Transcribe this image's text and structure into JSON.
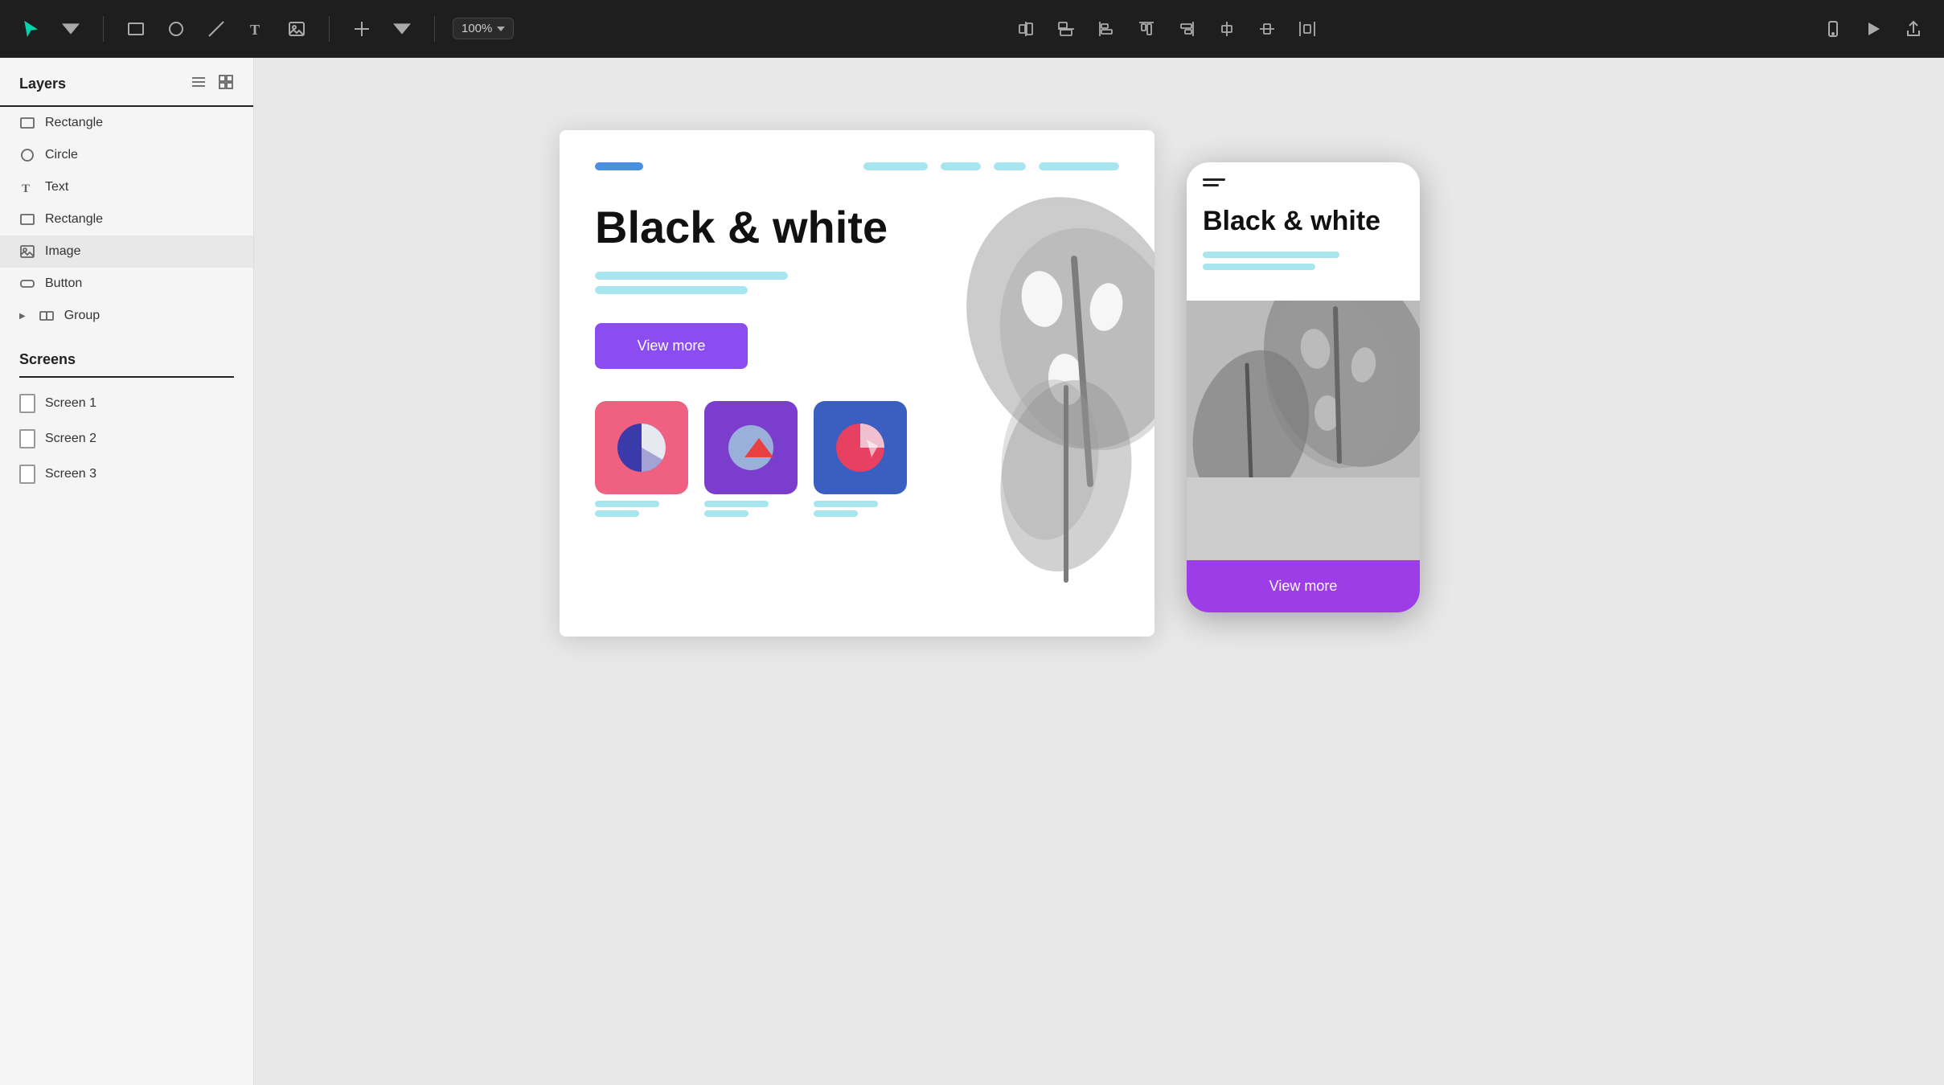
{
  "toolbar": {
    "zoom": "100%",
    "zoom_dropdown": "▾",
    "tools": [
      {
        "name": "select-tool",
        "label": "Select"
      },
      {
        "name": "rectangle-tool",
        "label": "Rectangle"
      },
      {
        "name": "circle-tool",
        "label": "Circle"
      },
      {
        "name": "line-tool",
        "label": "Line"
      },
      {
        "name": "text-tool",
        "label": "Text"
      },
      {
        "name": "image-tool",
        "label": "Image"
      },
      {
        "name": "add-tool",
        "label": "Add"
      }
    ],
    "align_tools": [
      {
        "name": "align-h-center",
        "label": "Align Horizontal Center"
      },
      {
        "name": "align-v-center",
        "label": "Align Vertical Center"
      },
      {
        "name": "align-left",
        "label": "Align Left"
      },
      {
        "name": "align-top",
        "label": "Align Top"
      },
      {
        "name": "align-right",
        "label": "Align Right"
      },
      {
        "name": "distribute-v",
        "label": "Distribute Vertically"
      },
      {
        "name": "distribute-h",
        "label": "Distribute Horizontally"
      },
      {
        "name": "align-h-spread",
        "label": "Align Horizontal Spread"
      }
    ],
    "right_tools": [
      {
        "name": "mobile-preview",
        "label": "Mobile Preview"
      },
      {
        "name": "play-preview",
        "label": "Play Preview"
      },
      {
        "name": "share",
        "label": "Share"
      }
    ]
  },
  "sidebar": {
    "layers_title": "Layers",
    "layers": [
      {
        "id": "layer-rectangle-1",
        "label": "Rectangle",
        "type": "rectangle"
      },
      {
        "id": "layer-circle",
        "label": "Circle",
        "type": "circle"
      },
      {
        "id": "layer-text",
        "label": "Text",
        "type": "text"
      },
      {
        "id": "layer-rectangle-2",
        "label": "Rectangle",
        "type": "rectangle"
      },
      {
        "id": "layer-image",
        "label": "Image",
        "type": "image",
        "active": true
      },
      {
        "id": "layer-button",
        "label": "Button",
        "type": "button"
      },
      {
        "id": "layer-group",
        "label": "Group",
        "type": "group"
      }
    ],
    "screens_title": "Screens",
    "screens": [
      {
        "id": "screen-1",
        "label": "Screen 1"
      },
      {
        "id": "screen-2",
        "label": "Screen 2"
      },
      {
        "id": "screen-3",
        "label": "Screen 3"
      }
    ]
  },
  "canvas": {
    "design": {
      "hero_title": "Black & white",
      "button_label": "View more",
      "nav_logo_color": "#4a90e2",
      "nav_link_color": "#a8e6ef",
      "button_color": "#8b4df0"
    }
  },
  "mobile": {
    "hero_title": "Black & white",
    "button_label": "View more",
    "button_color": "#9c3de8"
  }
}
